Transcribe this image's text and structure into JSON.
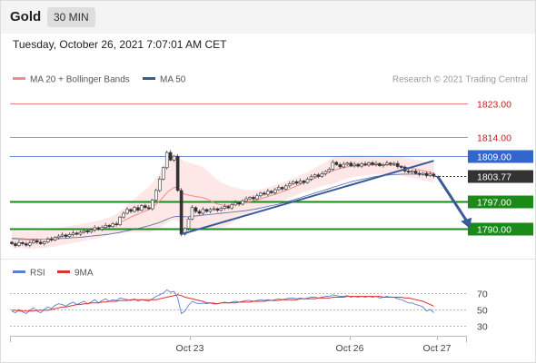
{
  "header": {
    "instrument": "Gold",
    "timeframe": "30 MIN",
    "timestamp": "Tuesday, October 26, 2021 7:07:01 AM CET"
  },
  "legend": {
    "ma20": "MA 20 + Bollinger Bands",
    "ma50": "MA 50",
    "rsi": "RSI",
    "ma9": "9MA",
    "copyright": "Research © 2021 Trading Central"
  },
  "colors": {
    "ma20": "#f28b8b",
    "ma50": "#3a5a96",
    "bollinger_fill": "#fde3e3",
    "support": "#1b8a1b",
    "resistance": "#ef8080",
    "pivot": "#3366cc",
    "current": "#333333",
    "trend": "#3a5a9a",
    "rsi": "#5b7fd1",
    "ma9": "#e03030",
    "candle_up": "#ffffff",
    "candle_down": "#333333"
  },
  "chart_data": [
    {
      "type": "candlestick",
      "ylim": [
        1783.5,
        1826
      ],
      "x_ticks": [
        "Oct 23",
        "Oct 26",
        "Oct 27"
      ],
      "price_levels": [
        {
          "label": "1823.00",
          "value": 1823.0,
          "role": "resistance"
        },
        {
          "label": "1814.00",
          "value": 1814.0,
          "role": "resistance"
        },
        {
          "label": "1809.00",
          "value": 1809.0,
          "role": "pivot"
        },
        {
          "label": "1803.77",
          "value": 1803.77,
          "role": "current"
        },
        {
          "label": "1797.00",
          "value": 1797.0,
          "role": "support"
        },
        {
          "label": "1790.00",
          "value": 1790.0,
          "role": "support"
        }
      ],
      "closes": [
        1786,
        1785.5,
        1786.3,
        1786,
        1785.6,
        1786.2,
        1786.8,
        1786.4,
        1786,
        1786.5,
        1787.2,
        1787,
        1787.6,
        1788,
        1788.3,
        1787.9,
        1788.4,
        1788.8,
        1788.5,
        1789,
        1789.4,
        1789.1,
        1789.6,
        1790.2,
        1789.8,
        1790.3,
        1790.8,
        1790.5,
        1791.2,
        1791,
        1793,
        1794,
        1795,
        1794.5,
        1795.5,
        1794.8,
        1796,
        1795.5,
        1795.2,
        1797.5,
        1800,
        1803,
        1806,
        1810,
        1808,
        1809,
        1800,
        1788.5,
        1790,
        1792.5,
        1795.5,
        1794.5,
        1794,
        1795,
        1794.5,
        1795,
        1795.2,
        1794.8,
        1795.3,
        1795.8,
        1795.4,
        1796.2,
        1796.8,
        1796.4,
        1797.2,
        1797.8,
        1798.2,
        1797.8,
        1798.6,
        1799.3,
        1799,
        1799.8,
        1799.4,
        1800.2,
        1800.8,
        1800.4,
        1801.2,
        1801.8,
        1802.3,
        1801.9,
        1802.5,
        1802.1,
        1803,
        1803.6,
        1804.1,
        1803.7,
        1804.4,
        1805,
        1805.6,
        1807.4,
        1806.8,
        1806.2,
        1806.9,
        1807.2,
        1806.5,
        1806.9,
        1806.4,
        1807,
        1806.7,
        1807.3,
        1806.8,
        1807.1,
        1806.5,
        1806.8,
        1807.2,
        1806.9,
        1807.1,
        1806.3,
        1806.1,
        1805.1,
        1804.8,
        1805.1,
        1804.5,
        1804.2,
        1804.5,
        1803.9,
        1804.3,
        1803.77
      ],
      "ma20": [
        1787.2,
        1787.2,
        1787.1,
        1787.1,
        1787,
        1787,
        1787,
        1787.1,
        1787.1,
        1787.2,
        1787.3,
        1787.4,
        1787.6,
        1787.8,
        1788,
        1788.1,
        1788.3,
        1788.5,
        1788.6,
        1788.8,
        1789,
        1789.2,
        1789.4,
        1789.6,
        1789.8,
        1790,
        1790.3,
        1790.6,
        1790.9,
        1791.2,
        1791.6,
        1792,
        1792.5,
        1793,
        1793.4,
        1793.8,
        1794.2,
        1794.6,
        1795,
        1795.6,
        1796.4,
        1797.3,
        1798.3,
        1799.4,
        1800.2,
        1800.8,
        1800.8,
        1799.6,
        1799,
        1798.8,
        1798.6,
        1798.4,
        1798.3,
        1798.1,
        1797.8,
        1797.3,
        1796.8,
        1796.5,
        1796.2,
        1796.1,
        1796.1,
        1796.2,
        1796.4,
        1796.5,
        1796.7,
        1796.9,
        1797.1,
        1797.3,
        1797.5,
        1797.8,
        1798.1,
        1798.4,
        1798.7,
        1799,
        1799.3,
        1799.7,
        1800,
        1800.4,
        1800.8,
        1801.2,
        1801.6,
        1802,
        1802.4,
        1802.8,
        1803.2,
        1803.6,
        1804,
        1804.4,
        1804.8,
        1805.2,
        1805.5,
        1805.8,
        1806,
        1806.2,
        1806.3,
        1806.4,
        1806.5,
        1806.6,
        1806.6,
        1806.7,
        1806.7,
        1806.7,
        1806.7,
        1806.7,
        1806.7,
        1806.7,
        1806.6,
        1806.5,
        1806.4,
        1806.2,
        1806,
        1805.8,
        1805.6,
        1805.4,
        1805.2,
        1805,
        1804.8,
        1804.6
      ],
      "ma50": [
        1787.4,
        1787.4,
        1787.3,
        1787.3,
        1787.2,
        1787.2,
        1787.2,
        1787.2,
        1787.2,
        1787.2,
        1787.2,
        1787.2,
        1787.3,
        1787.3,
        1787.4,
        1787.4,
        1787.5,
        1787.6,
        1787.6,
        1787.7,
        1787.8,
        1787.9,
        1788,
        1788.1,
        1788.2,
        1788.3,
        1788.4,
        1788.5,
        1788.7,
        1788.8,
        1789,
        1789.2,
        1789.4,
        1789.6,
        1789.8,
        1790,
        1790.2,
        1790.5,
        1790.7,
        1791,
        1791.3,
        1791.6,
        1792,
        1792.4,
        1792.8,
        1793.1,
        1793.2,
        1793.1,
        1793.1,
        1793.1,
        1793.2,
        1793.3,
        1793.4,
        1793.5,
        1793.6,
        1793.7,
        1793.8,
        1793.9,
        1794,
        1794.1,
        1794.2,
        1794.3,
        1794.4,
        1794.5,
        1794.6,
        1794.7,
        1794.9,
        1795,
        1795.2,
        1795.4,
        1795.6,
        1795.8,
        1796,
        1796.2,
        1796.4,
        1796.7,
        1796.9,
        1797.2,
        1797.5,
        1797.8,
        1798.1,
        1798.4,
        1798.7,
        1799,
        1799.3,
        1799.6,
        1799.9,
        1800.2,
        1800.5,
        1800.8,
        1801.1,
        1801.4,
        1801.7,
        1802,
        1802.3,
        1802.5,
        1802.7,
        1802.9,
        1803.1,
        1803.3,
        1803.5,
        1803.7,
        1803.8,
        1803.9,
        1804,
        1804.1,
        1804.2,
        1804.2,
        1804.3,
        1804.3,
        1804.3,
        1804.3,
        1804.3,
        1804.3,
        1804.3,
        1804.3,
        1804.3,
        1804.3
      ],
      "bollinger_width": [
        2.2,
        2.2,
        2.2,
        2.2,
        2.3,
        2.3,
        2.3,
        2.3,
        2.3,
        2.3,
        2.3,
        2.3,
        2.3,
        2.3,
        2.3,
        2.3,
        2.3,
        2.3,
        2.3,
        2.3,
        2.3,
        2.3,
        2.3,
        2.3,
        2.3,
        2.3,
        2.3,
        2.3,
        2.4,
        2.6,
        2.9,
        3.2,
        3.6,
        4,
        4.4,
        4.8,
        5.2,
        5.6,
        6,
        6.4,
        6.8,
        7.2,
        7.6,
        8,
        8.3,
        8.5,
        8.6,
        8.6,
        8.6,
        8.6,
        8.5,
        8.4,
        8.2,
        8,
        7.6,
        7.2,
        6.8,
        6.4,
        6,
        5.6,
        5.2,
        4.8,
        4.4,
        4,
        3.6,
        3.3,
        3,
        2.8,
        2.6,
        2.5,
        2.4,
        2.4,
        2.4,
        2.4,
        2.4,
        2.4,
        2.4,
        2.4,
        2.4,
        2.4,
        2.4,
        2.4,
        2.5,
        2.6,
        2.7,
        2.8,
        2.9,
        3,
        3.2,
        3.4,
        3.4,
        3.3,
        3.2,
        3.1,
        3,
        2.9,
        2.8,
        2.7,
        2.6,
        2.6,
        2.5,
        2.5,
        2.5,
        2.5,
        2.5,
        2.5,
        2.5,
        2.5,
        2.5,
        2.5,
        2.5,
        2.5,
        2.5,
        2.5,
        2.5,
        2.5,
        2.5,
        2.5
      ],
      "trendline": [
        [
          47,
          1788.5
        ],
        [
          117,
          1807.8
        ]
      ],
      "forecast_arrow": [
        [
          118,
          1803.77
        ],
        [
          127,
          1790
        ]
      ]
    },
    {
      "type": "line",
      "name": "RSI",
      "ylim": [
        20,
        80
      ],
      "y_ticks": [
        70,
        50,
        30
      ],
      "rsi": [
        48,
        46,
        50,
        47,
        45,
        49,
        52,
        48,
        46,
        50,
        53,
        51,
        55,
        57,
        56,
        54,
        57,
        59,
        56,
        58,
        60,
        57,
        59,
        62,
        58,
        61,
        63,
        60,
        62,
        61,
        64,
        63,
        62,
        61,
        63,
        60,
        62,
        61,
        60,
        63,
        66,
        68,
        70,
        74,
        71,
        72,
        64,
        45,
        48,
        55,
        60,
        58,
        57,
        58,
        57,
        58,
        58,
        57,
        58,
        59,
        58,
        59,
        60,
        59,
        60,
        61,
        61,
        60,
        61,
        62,
        61,
        62,
        61,
        62,
        63,
        62,
        63,
        64,
        64,
        63,
        64,
        63,
        64,
        65,
        65,
        64,
        65,
        66,
        66,
        68,
        67,
        66,
        66,
        67,
        65,
        66,
        65,
        66,
        65,
        66,
        65,
        66,
        64,
        65,
        66,
        65,
        65,
        63,
        62,
        60,
        58,
        58,
        56,
        55,
        53,
        48,
        50,
        46
      ],
      "ma9": [
        49,
        49,
        48,
        48,
        48,
        48,
        48,
        49,
        49,
        49,
        49,
        50,
        51,
        52,
        53,
        53,
        54,
        55,
        56,
        56,
        57,
        57,
        58,
        58,
        58,
        59,
        59,
        60,
        60,
        60,
        61,
        61,
        61,
        62,
        62,
        62,
        62,
        62,
        62,
        62,
        62,
        63,
        64,
        65,
        66,
        67,
        68,
        67,
        65,
        64,
        63,
        62,
        61,
        60,
        58,
        58,
        57,
        57,
        58,
        58,
        58,
        58,
        58,
        59,
        59,
        59,
        59,
        60,
        60,
        60,
        60,
        61,
        61,
        61,
        61,
        62,
        62,
        62,
        62,
        62,
        63,
        63,
        63,
        63,
        63,
        64,
        64,
        64,
        64,
        65,
        65,
        65,
        65,
        66,
        66,
        66,
        66,
        66,
        66,
        66,
        66,
        66,
        66,
        65,
        65,
        65,
        65,
        65,
        65,
        64,
        64,
        63,
        62,
        61,
        60,
        58,
        56,
        54
      ]
    }
  ]
}
